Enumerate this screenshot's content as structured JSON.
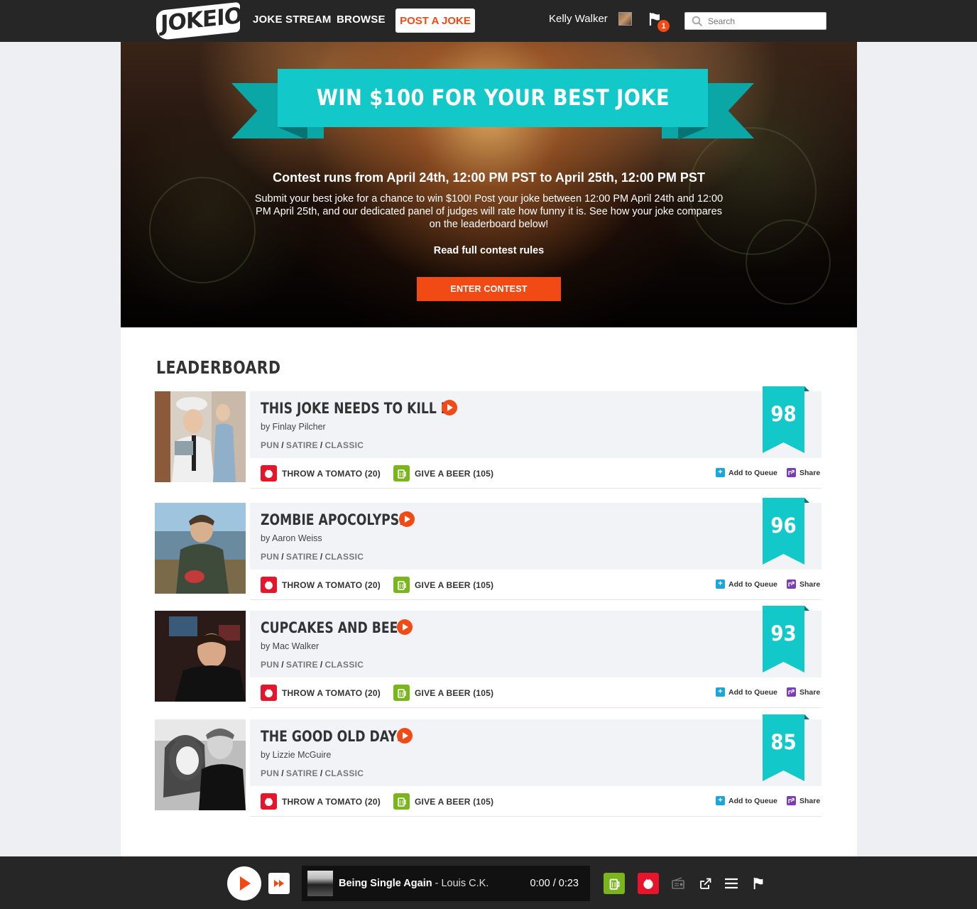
{
  "nav": {
    "logo_text": "JOKEIO",
    "links": [
      "JOKE STREAM",
      "BROWSE"
    ],
    "post_label": "POST A JOKE",
    "user_name": "Kelly Walker",
    "notification_count": "1",
    "search_placeholder": "Search"
  },
  "hero": {
    "banner": "WIN $100 FOR YOUR BEST JOKE",
    "subtitle": "Contest runs from April 24th, 12:00 PM PST to April 25th, 12:00 PM PST",
    "description": "Submit your best joke for a chance to win $100! Post your joke between 12:00 PM April 24th and 12:00 PM April 25th, and our dedicated panel of judges will rate how funny it is. See how your joke compares on the leaderboard below!",
    "rules_link": "Read full contest rules",
    "cta": "ENTER CONTEST"
  },
  "leaderboard": {
    "title": "LEADERBOARD",
    "entries": [
      {
        "title": "THIS JOKE NEEDS TO KILL IT",
        "author": "by Finlay Pilcher",
        "tags": [
          "PUN",
          "SATIRE",
          "CLASSIC"
        ],
        "tomato": "THROW A TOMATO (20)",
        "beer": "GIVE A BEER (105)",
        "queue": "Add to Queue",
        "share": "Share",
        "score": "98"
      },
      {
        "title": "ZOMBIE APOCOLYPSE",
        "author": "by Aaron Weiss",
        "tags": [
          "PUN",
          "SATIRE",
          "CLASSIC"
        ],
        "tomato": "THROW A TOMATO (20)",
        "beer": "GIVE A BEER (105)",
        "queue": "Add to Queue",
        "share": "Share",
        "score": "96"
      },
      {
        "title": "CUPCAKES AND BEER",
        "author": "by Mac Walker",
        "tags": [
          "PUN",
          "SATIRE",
          "CLASSIC"
        ],
        "tomato": "THROW A TOMATO (20)",
        "beer": "GIVE A BEER (105)",
        "queue": "Add to Queue",
        "share": "Share",
        "score": "93"
      },
      {
        "title": "THE GOOD OLD DAYS",
        "author": "by Lizzie McGuire",
        "tags": [
          "PUN",
          "SATIRE",
          "CLASSIC"
        ],
        "tomato": "THROW A TOMATO (20)",
        "beer": "GIVE A BEER (105)",
        "queue": "Add to Queue",
        "share": "Share",
        "score": "85"
      }
    ]
  },
  "player": {
    "song_title": "Being Single Again",
    "artist": "- Louis C.K.",
    "time": "0:00 / 0:23"
  },
  "colors": {
    "accent_orange": "#f24a14",
    "teal": "#12c8c8",
    "tomato_red": "#e5162b",
    "beer_green": "#7ab51d",
    "nav_bg": "#262626"
  }
}
